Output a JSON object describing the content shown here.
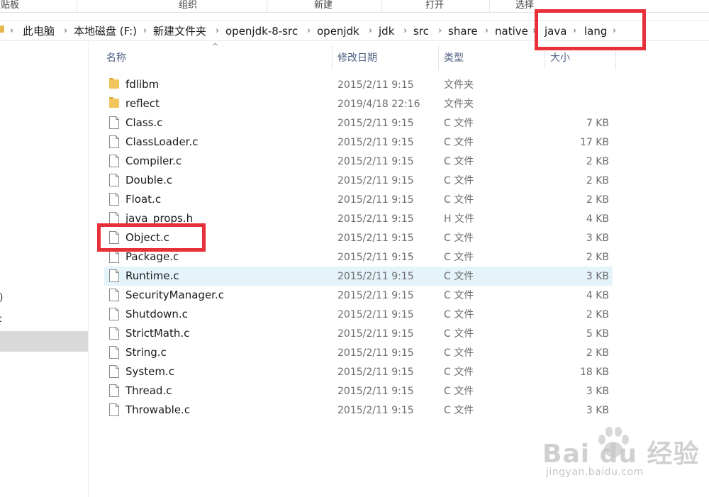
{
  "ribbon": {
    "groups": [
      "贴板",
      "组织",
      "新建",
      "打开",
      "选择"
    ]
  },
  "address": {
    "path": [
      "此电脑",
      "本地磁盘 (F:)",
      "新建文件夹",
      "openjdk-8-src",
      "openjdk",
      "jdk",
      "src",
      "share",
      "native",
      "java",
      "lang"
    ]
  },
  "nav": {
    "fragment_1": ")",
    "fragment_2": "ː"
  },
  "columns": {
    "name": "名称",
    "modified": "修改日期",
    "type": "类型",
    "size": "大小"
  },
  "files": [
    {
      "name": "fdlibm",
      "modified": "2015/2/11 9:15",
      "type": "文件夹",
      "size": "",
      "icon": "folder-icon"
    },
    {
      "name": "reflect",
      "modified": "2019/4/18 22:16",
      "type": "文件夹",
      "size": "",
      "icon": "folder-icon"
    },
    {
      "name": "Class.c",
      "modified": "2015/2/11 9:15",
      "type": "C 文件",
      "size": "7 KB",
      "icon": "file-icon"
    },
    {
      "name": "ClassLoader.c",
      "modified": "2015/2/11 9:15",
      "type": "C 文件",
      "size": "17 KB",
      "icon": "file-icon"
    },
    {
      "name": "Compiler.c",
      "modified": "2015/2/11 9:15",
      "type": "C 文件",
      "size": "2 KB",
      "icon": "file-icon"
    },
    {
      "name": "Double.c",
      "modified": "2015/2/11 9:15",
      "type": "C 文件",
      "size": "2 KB",
      "icon": "file-icon"
    },
    {
      "name": "Float.c",
      "modified": "2015/2/11 9:15",
      "type": "C 文件",
      "size": "2 KB",
      "icon": "file-icon"
    },
    {
      "name": "java_props.h",
      "modified": "2015/2/11 9:15",
      "type": "H 文件",
      "size": "4 KB",
      "icon": "file-icon"
    },
    {
      "name": "Object.c",
      "modified": "2015/2/11 9:15",
      "type": "C 文件",
      "size": "3 KB",
      "icon": "file-icon"
    },
    {
      "name": "Package.c",
      "modified": "2015/2/11 9:15",
      "type": "C 文件",
      "size": "2 KB",
      "icon": "file-icon"
    },
    {
      "name": "Runtime.c",
      "modified": "2015/2/11 9:15",
      "type": "C 文件",
      "size": "3 KB",
      "icon": "file-icon"
    },
    {
      "name": "SecurityManager.c",
      "modified": "2015/2/11 9:15",
      "type": "C 文件",
      "size": "4 KB",
      "icon": "file-icon"
    },
    {
      "name": "Shutdown.c",
      "modified": "2015/2/11 9:15",
      "type": "C 文件",
      "size": "2 KB",
      "icon": "file-icon"
    },
    {
      "name": "StrictMath.c",
      "modified": "2015/2/11 9:15",
      "type": "C 文件",
      "size": "5 KB",
      "icon": "file-icon"
    },
    {
      "name": "String.c",
      "modified": "2015/2/11 9:15",
      "type": "C 文件",
      "size": "2 KB",
      "icon": "file-icon"
    },
    {
      "name": "System.c",
      "modified": "2015/2/11 9:15",
      "type": "C 文件",
      "size": "18 KB",
      "icon": "file-icon"
    },
    {
      "name": "Thread.c",
      "modified": "2015/2/11 9:15",
      "type": "C 文件",
      "size": "3 KB",
      "icon": "file-icon"
    },
    {
      "name": "Throwable.c",
      "modified": "2015/2/11 9:15",
      "type": "C 文件",
      "size": "3 KB",
      "icon": "file-icon"
    }
  ],
  "hovered_file": "Runtime.c",
  "watermark": {
    "logo": "Bai du 经验",
    "url": "jingyan.baidu.com"
  },
  "colors": {
    "highlight": "#e8303a",
    "hover_row": "#e5f3fb",
    "folder": "#f2c55c"
  }
}
